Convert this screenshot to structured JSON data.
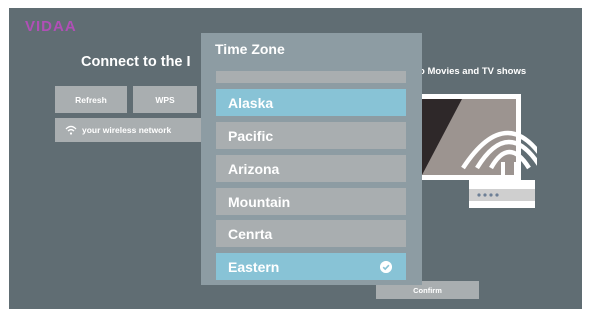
{
  "brand": {
    "logo_text": "VIDAA"
  },
  "background": {
    "title": "Connect to the I",
    "right_text": "o Movies and TV shows",
    "refresh_label": "Refresh",
    "wps_label": "WPS",
    "network_label": "your wireless network",
    "confirm_label": "Confirm"
  },
  "dialog": {
    "title": "Time Zone",
    "options": [
      {
        "label": "",
        "selected": false
      },
      {
        "label": "Alaska",
        "selected": true
      },
      {
        "label": "Pacific",
        "selected": false
      },
      {
        "label": "Arizona",
        "selected": false
      },
      {
        "label": "Mountain",
        "selected": false
      },
      {
        "label": "Cenrta",
        "selected": false
      },
      {
        "label": "Eastern",
        "selected": true,
        "checked": true
      }
    ]
  },
  "colors": {
    "screen_bg": "#606d73",
    "dialog_bg": "#8d9ca3",
    "option_bg": "#a9aeb0",
    "option_selected_bg": "#88c3d6",
    "logo": "#b04fb6"
  },
  "icons": {
    "wifi": "wifi-icon",
    "check": "check-circle-icon",
    "router": "router-illustration"
  }
}
